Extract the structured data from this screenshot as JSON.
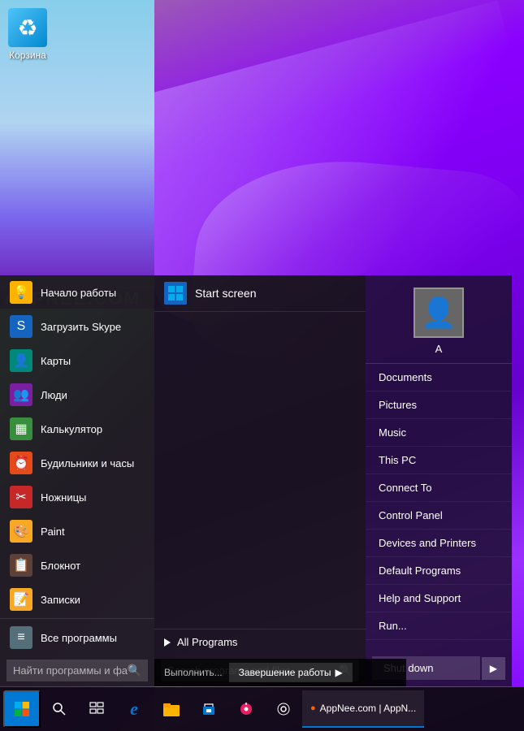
{
  "desktop": {
    "recycle_bin_label": "Корзина"
  },
  "watermark": "APPNEE.COM",
  "start_menu": {
    "app_list": [
      {
        "id": "startup",
        "label": "Начало работы",
        "icon": "💡",
        "color": "icon-yellow"
      },
      {
        "id": "skype",
        "label": "Загрузить Skype",
        "icon": "S",
        "color": "icon-blue"
      },
      {
        "id": "maps",
        "label": "Карты",
        "icon": "👤",
        "color": "icon-teal"
      },
      {
        "id": "people",
        "label": "Люди",
        "icon": "👥",
        "color": "icon-purple"
      },
      {
        "id": "calc",
        "label": "Калькулятор",
        "icon": "▦",
        "color": "icon-green"
      },
      {
        "id": "alarms",
        "label": "Будильники и часы",
        "icon": "⏰",
        "color": "icon-orange"
      },
      {
        "id": "scissors",
        "label": "Ножницы",
        "icon": "✂",
        "color": "icon-red"
      },
      {
        "id": "paint",
        "label": "Paint",
        "icon": "🎨",
        "color": "icon-yellow2"
      },
      {
        "id": "notepad",
        "label": "Блокнот",
        "icon": "📋",
        "color": "icon-brown"
      },
      {
        "id": "sticky",
        "label": "Записки",
        "icon": "📝",
        "color": "icon-yellow2"
      },
      {
        "id": "allprograms2",
        "label": "Все программы",
        "icon": "≡",
        "color": "icon-gray"
      }
    ],
    "search_placeholder": "Найти программы и файлы",
    "middle": {
      "start_screen_label": "Start screen",
      "all_programs_label": "All Programs",
      "search_placeholder": "Search programs and files"
    },
    "right": {
      "user_name": "A",
      "menu_items": [
        {
          "id": "documents",
          "label": "Documents"
        },
        {
          "id": "pictures",
          "label": "Pictures"
        },
        {
          "id": "music",
          "label": "Music"
        },
        {
          "id": "thispc",
          "label": "This PC"
        },
        {
          "id": "connectto",
          "label": "Connect To"
        },
        {
          "id": "controlpanel",
          "label": "Control Panel"
        },
        {
          "id": "devices",
          "label": "Devices and Printers"
        },
        {
          "id": "default",
          "label": "Default Programs"
        },
        {
          "id": "help",
          "label": "Help and Support"
        },
        {
          "id": "run",
          "label": "Run..."
        }
      ],
      "shutdown_label": "Shut down",
      "shutdown_arrow": "▶"
    }
  },
  "notification_bar": {
    "text": "Выполнить...",
    "finish_work_label": "Завершение работы",
    "arrow": "▶"
  },
  "taskbar": {
    "start_icon": "⊞",
    "apps": [
      {
        "id": "search",
        "icon": "🔍"
      },
      {
        "id": "multitask",
        "icon": "⬜"
      },
      {
        "id": "edge",
        "icon": "e"
      },
      {
        "id": "file",
        "icon": "📁"
      },
      {
        "id": "store",
        "icon": "🛍"
      },
      {
        "id": "media",
        "icon": "🎵"
      },
      {
        "id": "settings",
        "icon": "⚙"
      }
    ],
    "active_app_label": "AppNee.com | AppN..."
  }
}
